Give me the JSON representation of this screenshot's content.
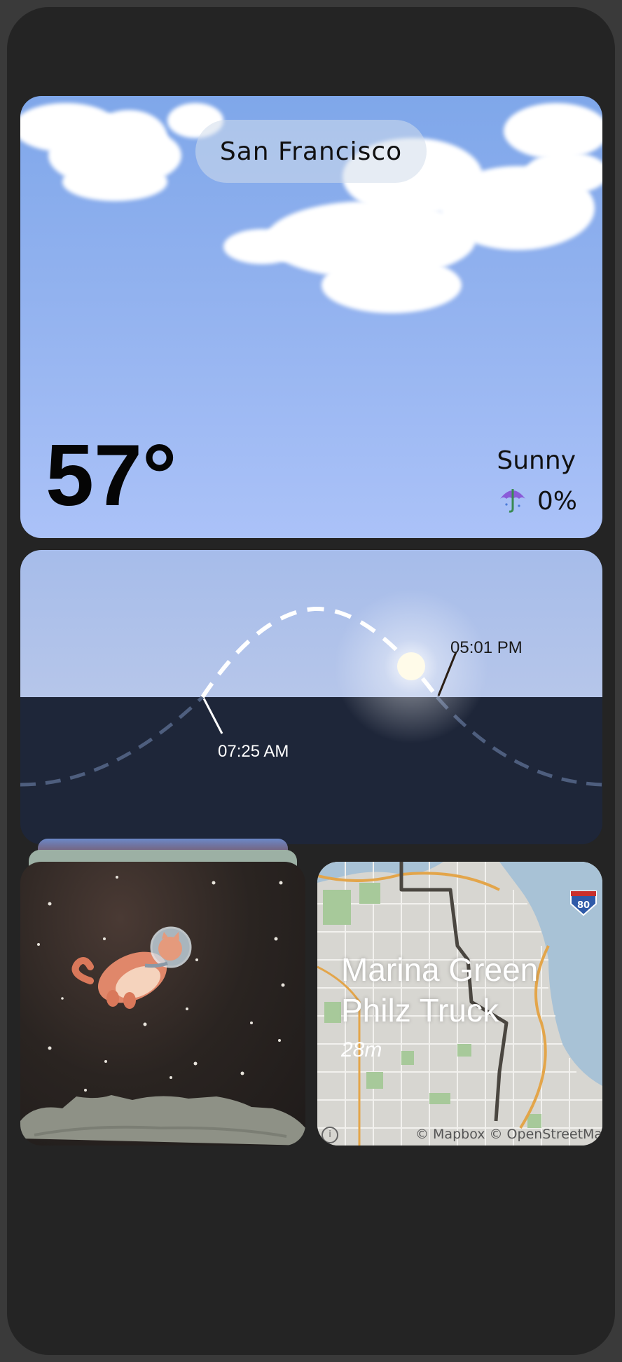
{
  "weather": {
    "city": "San Francisco",
    "temperature": "57°",
    "condition": "Sunny",
    "precipitation": "0%",
    "precip_icon": "umbrella-icon"
  },
  "sun": {
    "sunrise": "07:25 AM",
    "sunset": "05:01 PM"
  },
  "photo": {
    "subject": "astronaut-cat-illustration"
  },
  "map": {
    "destination_line1": "Marina Green",
    "destination_line2": "Philz Truck",
    "duration": "28m",
    "attribution": "© Mapbox © OpenStreetMap",
    "highway_shield": "80"
  },
  "colors": {
    "background": "#242424",
    "sky_top": "#7fa7ea",
    "sky_bottom": "#abc2f8",
    "night": "#1e2639"
  }
}
